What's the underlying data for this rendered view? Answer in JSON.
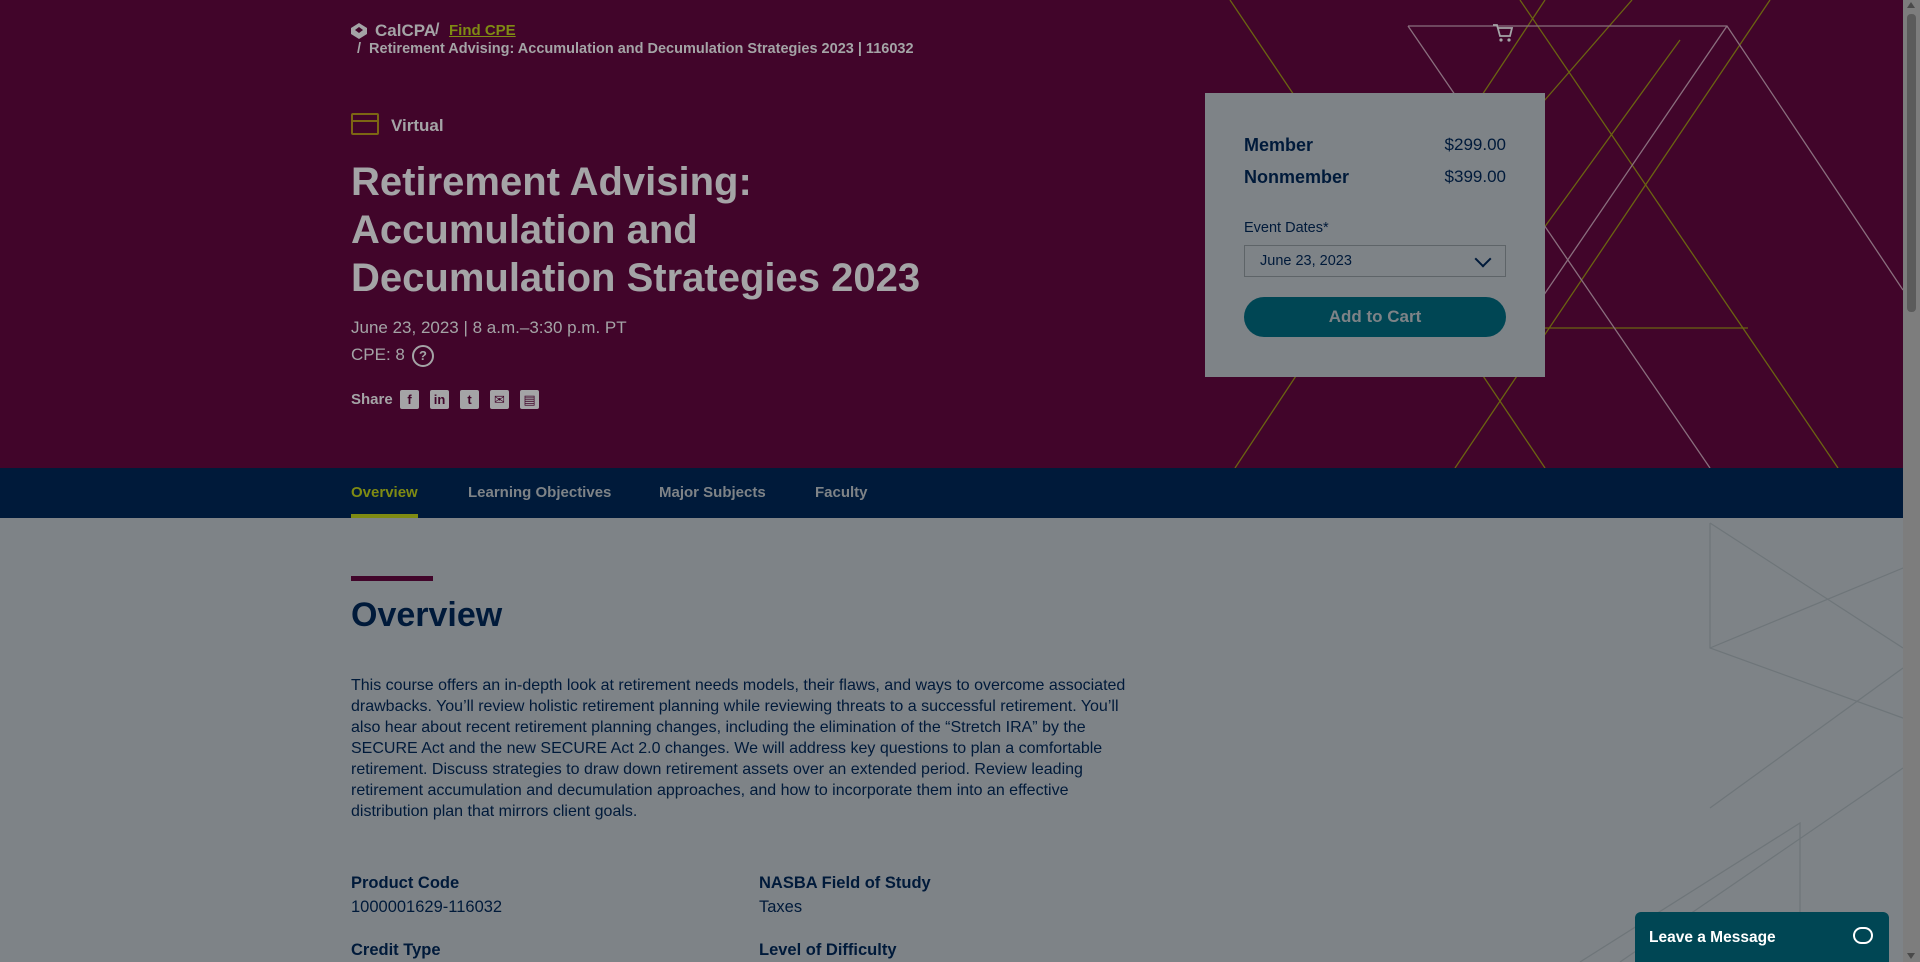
{
  "breadcrumb": {
    "brand": "CalCPA",
    "separator": "/",
    "link": "Find CPE",
    "current": "Retirement Advising: Accumulation and Decumulation Strategies 2023 | 116032"
  },
  "course": {
    "format_label": "Virtual",
    "title": "Retirement Advising: Accumulation and Decumulation Strategies 2023",
    "dates": "June 23, 2023 | 8 a.m.–3:30 p.m. PT",
    "cpe": "CPE: 8",
    "cpe_help": "?",
    "share_label": "Share",
    "share_icons": [
      "facebook-icon",
      "linkedin-icon",
      "twitter-icon",
      "email-icon",
      "print-icon"
    ]
  },
  "pricing": {
    "member_label": "Member",
    "member_price": "$299.00",
    "nonmember_label": "Nonmember",
    "nonmember_price": "$399.00",
    "event_dates_label": "Event Dates*",
    "event_date_selected": "June 23, 2023",
    "add_to_cart": "Add to Cart"
  },
  "tabs": [
    {
      "label": "Overview",
      "active": true
    },
    {
      "label": "Learning Objectives",
      "active": false
    },
    {
      "label": "Major Subjects",
      "active": false
    },
    {
      "label": "Faculty",
      "active": false
    }
  ],
  "overview": {
    "heading": "Overview",
    "body": "This course offers an in-depth look at retirement needs models, their flaws, and ways to overcome associated drawbacks. You’ll review holistic retirement planning while reviewing threats to a successful retirement. You’ll also hear about recent retirement planning changes, including the elimination of the “Stretch IRA” by the SECURE Act and the new SECURE Act 2.0 changes. We will address key questions to plan a comfortable retirement. Discuss strategies to draw down retirement assets over an extended period. Review leading retirement accumulation and decumulation approaches, and how to incorporate them into an effective distribution plan that mirrors client goals.",
    "product_code_label": "Product Code",
    "product_code": "1000001629-116032",
    "field_label": "NASBA Field of Study",
    "field": "Taxes",
    "credit_type_label": "Credit Type",
    "difficulty_label": "Level of Difficulty"
  },
  "chat": {
    "label": "Leave a Message"
  },
  "colors": {
    "hero_bg": "#41052a",
    "tabbar_bg": "#001a3a",
    "accent": "#7f8b13",
    "button": "#004654",
    "overlay_content": "#7e8387"
  }
}
